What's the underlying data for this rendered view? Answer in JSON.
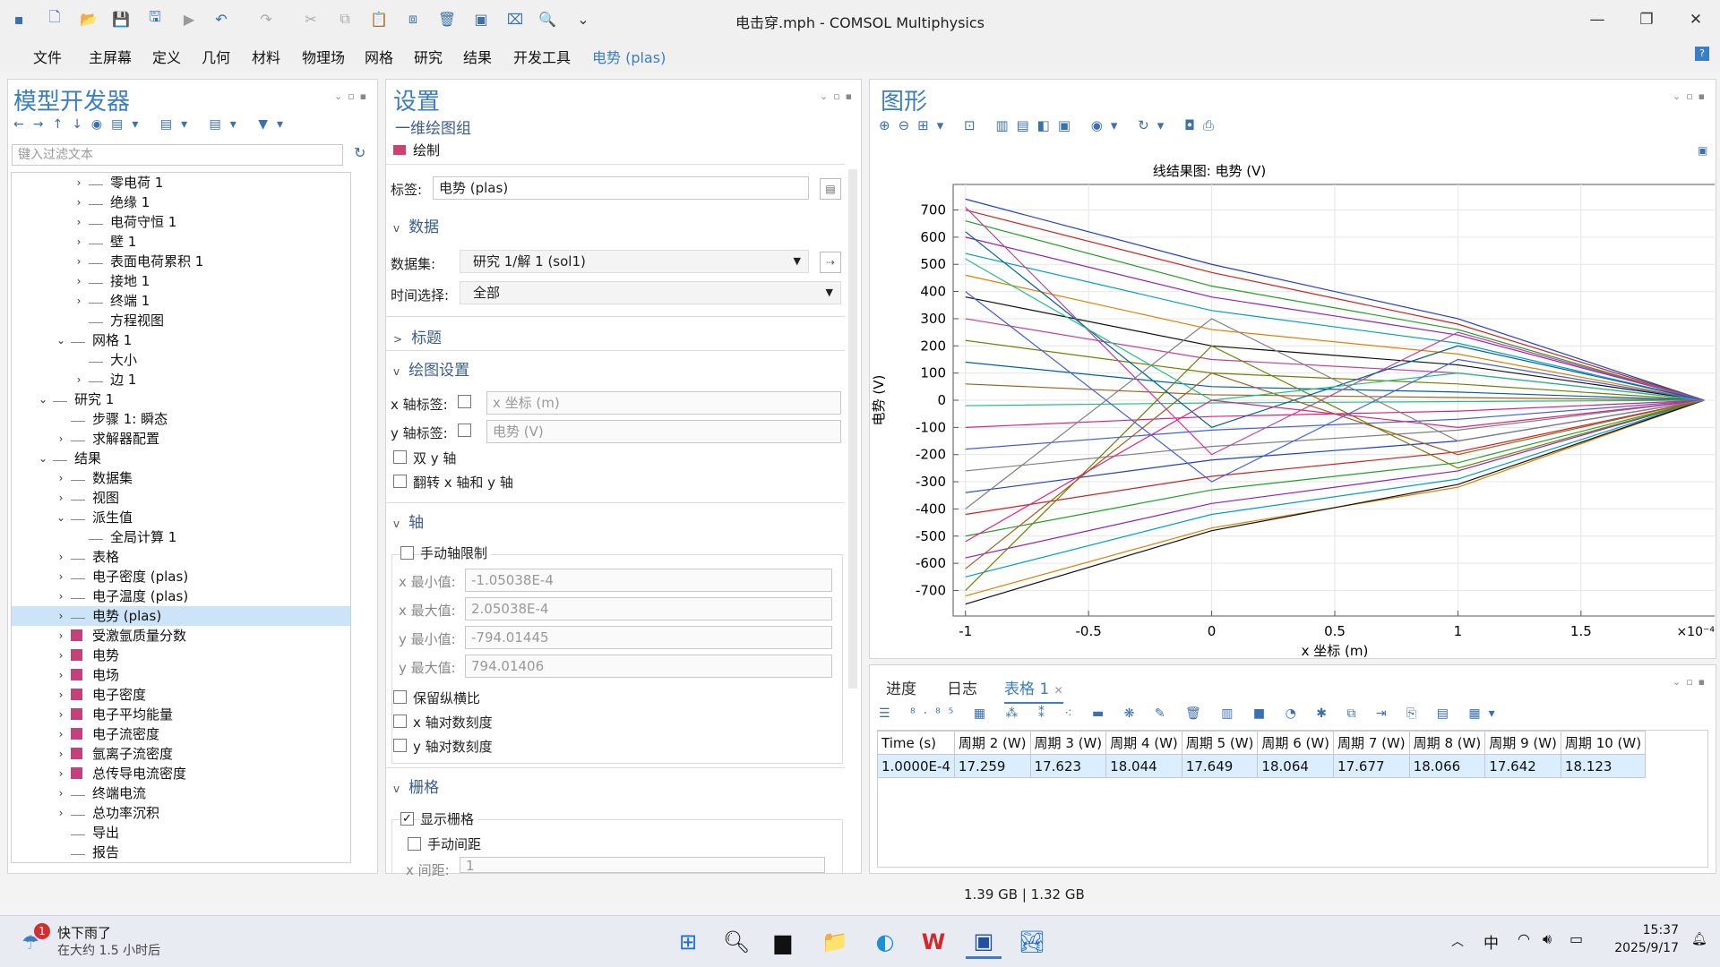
{
  "window": {
    "title": "电击穿.mph - COMSOL Multiphysics"
  },
  "menu": [
    "文件",
    "主屏幕",
    "定义",
    "几何",
    "材料",
    "物理场",
    "网格",
    "研究",
    "结果",
    "开发工具",
    "电势 (plas)"
  ],
  "model_builder": {
    "title": "模型开发器",
    "filter_placeholder": "键入过滤文本",
    "tree": [
      {
        "label": "零电荷 1",
        "level": 4,
        "arrow": ">"
      },
      {
        "label": "绝缘 1",
        "level": 4,
        "arrow": ">"
      },
      {
        "label": "电荷守恒 1",
        "level": 4,
        "arrow": ">"
      },
      {
        "label": "壁 1",
        "level": 4,
        "arrow": ">"
      },
      {
        "label": "表面电荷累积 1",
        "level": 4,
        "arrow": ">"
      },
      {
        "label": "接地 1",
        "level": 4,
        "arrow": ">"
      },
      {
        "label": "终端 1",
        "level": 4,
        "arrow": ">"
      },
      {
        "label": "方程视图",
        "level": 4,
        "arrow": ""
      },
      {
        "label": "网格 1",
        "level": 3,
        "arrow": "v"
      },
      {
        "label": "大小",
        "level": 4,
        "arrow": ""
      },
      {
        "label": "边 1",
        "level": 4,
        "arrow": ">"
      },
      {
        "label": "研究 1",
        "level": 2,
        "arrow": "v"
      },
      {
        "label": "步骤 1: 瞬态",
        "level": 3,
        "arrow": ""
      },
      {
        "label": "求解器配置",
        "level": 3,
        "arrow": ">"
      },
      {
        "label": "结果",
        "level": 2,
        "arrow": "v"
      },
      {
        "label": "数据集",
        "level": 3,
        "arrow": ">"
      },
      {
        "label": "视图",
        "level": 3,
        "arrow": ">"
      },
      {
        "label": "派生值",
        "level": 3,
        "arrow": "v"
      },
      {
        "label": "全局计算 1",
        "level": 4,
        "arrow": ""
      },
      {
        "label": "表格",
        "level": 3,
        "arrow": ">"
      },
      {
        "label": "电子密度 (plas)",
        "level": 3,
        "arrow": ">"
      },
      {
        "label": "电子温度 (plas)",
        "level": 3,
        "arrow": ">"
      },
      {
        "label": "电势 (plas)",
        "level": 3,
        "arrow": ">",
        "selected": true
      },
      {
        "label": "受激氩质量分数",
        "level": 3,
        "arrow": ">"
      },
      {
        "label": "电势",
        "level": 3,
        "arrow": ">"
      },
      {
        "label": "电场",
        "level": 3,
        "arrow": ">"
      },
      {
        "label": "电子密度",
        "level": 3,
        "arrow": ">"
      },
      {
        "label": "电子平均能量",
        "level": 3,
        "arrow": ">"
      },
      {
        "label": "电子流密度",
        "level": 3,
        "arrow": ">"
      },
      {
        "label": "氩离子流密度",
        "level": 3,
        "arrow": ">"
      },
      {
        "label": "总传导电流密度",
        "level": 3,
        "arrow": ">"
      },
      {
        "label": "终端电流",
        "level": 3,
        "arrow": ">"
      },
      {
        "label": "总功率沉积",
        "level": 3,
        "arrow": ">"
      },
      {
        "label": "导出",
        "level": 3,
        "arrow": ""
      },
      {
        "label": "报告",
        "level": 3,
        "arrow": ""
      }
    ]
  },
  "settings": {
    "title": "设置",
    "subtitle": "一维绘图组",
    "plot_button": "绘制",
    "label_field": {
      "label": "标签:",
      "value": "电势 (plas)"
    },
    "data_section": "数据",
    "dataset": {
      "label": "数据集:",
      "value": "研究 1/解 1 (sol1)"
    },
    "time_selection": {
      "label": "时间选择:",
      "value": "全部"
    },
    "title_section": "标题",
    "plot_settings_section": "绘图设置",
    "x_axis_label": {
      "label": "x 轴标签:",
      "placeholder": "x 坐标 (m)"
    },
    "y_axis_label": {
      "label": "y 轴标签:",
      "placeholder": "电势 (V)"
    },
    "dual_y": "双 y 轴",
    "flip_xy": "翻转 x 轴和 y 轴",
    "axis_section": "轴",
    "manual_limits": "手动轴限制",
    "x_min": {
      "label": "x 最小值:",
      "value": "-1.05038E-4"
    },
    "x_max": {
      "label": "x 最大值:",
      "value": "2.05038E-4"
    },
    "y_min": {
      "label": "y 最小值:",
      "value": "-794.01445"
    },
    "y_max": {
      "label": "y 最大值:",
      "value": "794.01406"
    },
    "keep_aspect": "保留纵横比",
    "x_log": "x 轴对数刻度",
    "y_log": "y 轴对数刻度",
    "grid_section": "栅格",
    "show_grid": "显示栅格",
    "manual_spacing": "手动间距",
    "x_spacing": {
      "label": "x 间距:",
      "value": "1"
    }
  },
  "graphics": {
    "title": "图形",
    "plot_title": "线结果图: 电势 (V)",
    "xlabel": "x 坐标 (m)",
    "ylabel": "电势 (V)",
    "x_multiplier": "×10⁻⁴",
    "x_ticks": [
      "-1",
      "-0.5",
      "0",
      "0.5",
      "1",
      "1.5"
    ],
    "y_ticks": [
      "700",
      "600",
      "500",
      "400",
      "300",
      "200",
      "100",
      "0",
      "-100",
      "-200",
      "-300",
      "-400",
      "-500",
      "-600",
      "-700"
    ]
  },
  "chart_data": {
    "type": "line",
    "title": "线结果图: 电势 (V)",
    "xlabel": "x 坐标 (m)",
    "ylabel": "电势 (V)",
    "x_scale_note": "×10⁻⁴",
    "xlim": [
      -1.05,
      2.05
    ],
    "ylim": [
      -794,
      794
    ],
    "x": [
      -1,
      0,
      1,
      2
    ],
    "series_description_count": 30,
    "series": [
      {
        "values": [
          740,
          500,
          300,
          0
        ]
      },
      {
        "values": [
          700,
          470,
          280,
          0
        ]
      },
      {
        "values": [
          660,
          420,
          260,
          0
        ]
      },
      {
        "values": [
          600,
          380,
          240,
          0
        ]
      },
      {
        "values": [
          540,
          330,
          210,
          0
        ]
      },
      {
        "values": [
          460,
          260,
          170,
          0
        ]
      },
      {
        "values": [
          380,
          200,
          130,
          0
        ]
      },
      {
        "values": [
          300,
          150,
          100,
          0
        ]
      },
      {
        "values": [
          220,
          100,
          60,
          0
        ]
      },
      {
        "values": [
          140,
          50,
          30,
          0
        ]
      },
      {
        "values": [
          60,
          20,
          10,
          0
        ]
      },
      {
        "values": [
          -20,
          -10,
          -5,
          0
        ]
      },
      {
        "values": [
          -100,
          -60,
          -40,
          0
        ]
      },
      {
        "values": [
          -180,
          -110,
          -70,
          0
        ]
      },
      {
        "values": [
          -260,
          -170,
          -110,
          0
        ]
      },
      {
        "values": [
          -340,
          -220,
          -150,
          0
        ]
      },
      {
        "values": [
          -420,
          -280,
          -190,
          0
        ]
      },
      {
        "values": [
          -500,
          -330,
          -230,
          0
        ]
      },
      {
        "values": [
          -580,
          -380,
          -260,
          0
        ]
      },
      {
        "values": [
          -650,
          -420,
          -290,
          0
        ]
      },
      {
        "values": [
          -720,
          -470,
          -320,
          0
        ]
      },
      {
        "values": [
          -750,
          -480,
          -310,
          0
        ]
      },
      {
        "values": [
          710,
          -200,
          250,
          0
        ]
      },
      {
        "values": [
          -700,
          200,
          -250,
          0
        ]
      },
      {
        "values": [
          620,
          -100,
          200,
          0
        ]
      },
      {
        "values": [
          -620,
          100,
          -200,
          0
        ]
      },
      {
        "values": [
          520,
          0,
          100,
          0
        ]
      },
      {
        "values": [
          -520,
          0,
          -100,
          0
        ]
      },
      {
        "values": [
          400,
          -300,
          150,
          0
        ]
      },
      {
        "values": [
          -400,
          300,
          -150,
          0
        ]
      }
    ],
    "grid": true
  },
  "bottom_tabs": [
    "进度",
    "日志",
    "表格 1"
  ],
  "table": {
    "headers": [
      "Time (s)",
      "周期 2 (W)",
      "周期 3 (W)",
      "周期 4 (W)",
      "周期 5 (W)",
      "周期 6 (W)",
      "周期 7 (W)",
      "周期 8 (W)",
      "周期 9 (W)",
      "周期 10 (W)"
    ],
    "rows": [
      [
        "1.0000E-4",
        "17.259",
        "17.623",
        "18.044",
        "17.649",
        "18.064",
        "17.677",
        "18.066",
        "17.642",
        "18.123"
      ]
    ]
  },
  "status": {
    "memory": "1.39 GB | 1.32 GB"
  },
  "taskbar": {
    "weather_title": "快下雨了",
    "weather_sub": "在大约 1.5 小时后",
    "weather_badge": "1",
    "ime": "中",
    "time": "15:37",
    "date": "2025/9/17"
  },
  "colors": {
    "accent": "#3b7ec4",
    "selection": "#cce4f7"
  }
}
